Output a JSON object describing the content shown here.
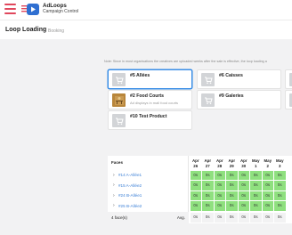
{
  "header": {
    "brand_name": "AdLoops",
    "brand_subtitle": "Campaign Control"
  },
  "subheader": {
    "title": "Loop Loading",
    "subtitle": "Booking"
  },
  "note": "Note: Since in most organisations the creatives are uploaded weeks after the sale is effective, the loop loading a",
  "cards": [
    {
      "title": "#5 Allées",
      "subtitle": ""
    },
    {
      "title": "#6 Caisses",
      "subtitle": ""
    },
    {
      "title": "#2 Food Courts",
      "subtitle": "Ad displays in mall food courts"
    },
    {
      "title": "#9 Galeries",
      "subtitle": ""
    },
    {
      "title": "#10 Test Product",
      "subtitle": ""
    }
  ],
  "schedule": {
    "faces_header": "Faces",
    "faces": [
      "#14 A-Allée1",
      "#15 A-Allée2",
      "#24 B-Allée1",
      "#25 B-Allée2"
    ],
    "footer_count": "4 face(s)",
    "footer_avg": "Avg.",
    "dates": [
      {
        "month": "Apr",
        "day": "26"
      },
      {
        "month": "Apr",
        "day": "27"
      },
      {
        "month": "Apr",
        "day": "28"
      },
      {
        "month": "Apr",
        "day": "29"
      },
      {
        "month": "Apr",
        "day": "30"
      },
      {
        "month": "May",
        "day": "1"
      },
      {
        "month": "May",
        "day": "2"
      },
      {
        "month": "May",
        "day": "3"
      }
    ],
    "cell_value": "0s",
    "colors": {
      "filled": "#8fe07f",
      "accent": "#3a8ee6",
      "brand": "#e0475c"
    }
  }
}
